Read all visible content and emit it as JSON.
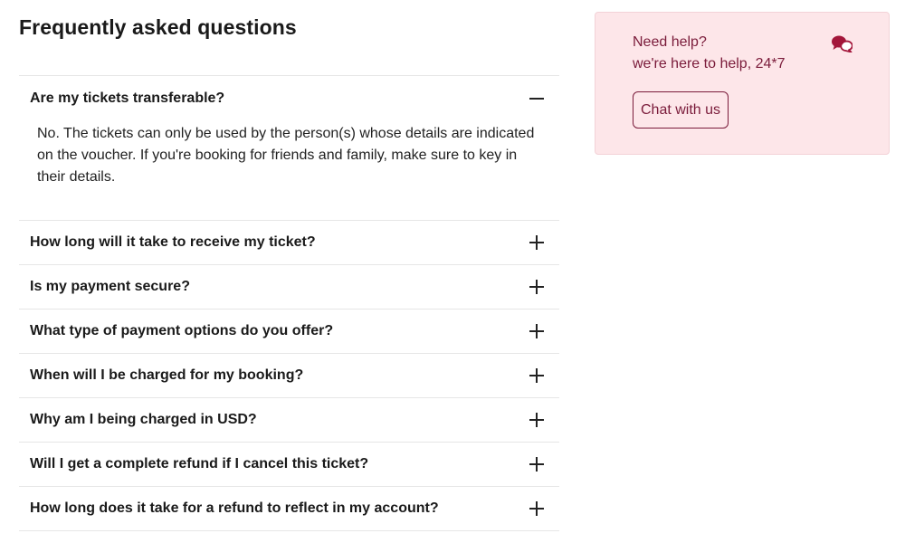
{
  "faq": {
    "title": "Frequently asked questions",
    "items": [
      {
        "question": "Are my tickets transferable?",
        "expanded": true,
        "answer": "No. The tickets can only be used by the person(s) whose details are indicated on the voucher. If you're booking for friends and family, make sure to key in their details."
      },
      {
        "question": "How long will it take to receive my ticket?",
        "expanded": false
      },
      {
        "question": "Is my payment secure?",
        "expanded": false
      },
      {
        "question": "What type of payment options do you offer?",
        "expanded": false
      },
      {
        "question": "When will I be charged for my booking?",
        "expanded": false
      },
      {
        "question": "Why am I being charged in USD?",
        "expanded": false
      },
      {
        "question": "Will I get a complete refund if I cancel this ticket?",
        "expanded": false
      },
      {
        "question": "How long does it take for a refund to reflect in my account?",
        "expanded": false
      }
    ]
  },
  "help": {
    "title": "Need help?",
    "subtitle": "we're here to help, 24*7",
    "button_label": "Chat with us",
    "icon": "chat-bubbles-icon"
  },
  "colors": {
    "accent": "#7a1b3a",
    "card_bg": "#fde6e9",
    "icon": "#a3163a"
  }
}
